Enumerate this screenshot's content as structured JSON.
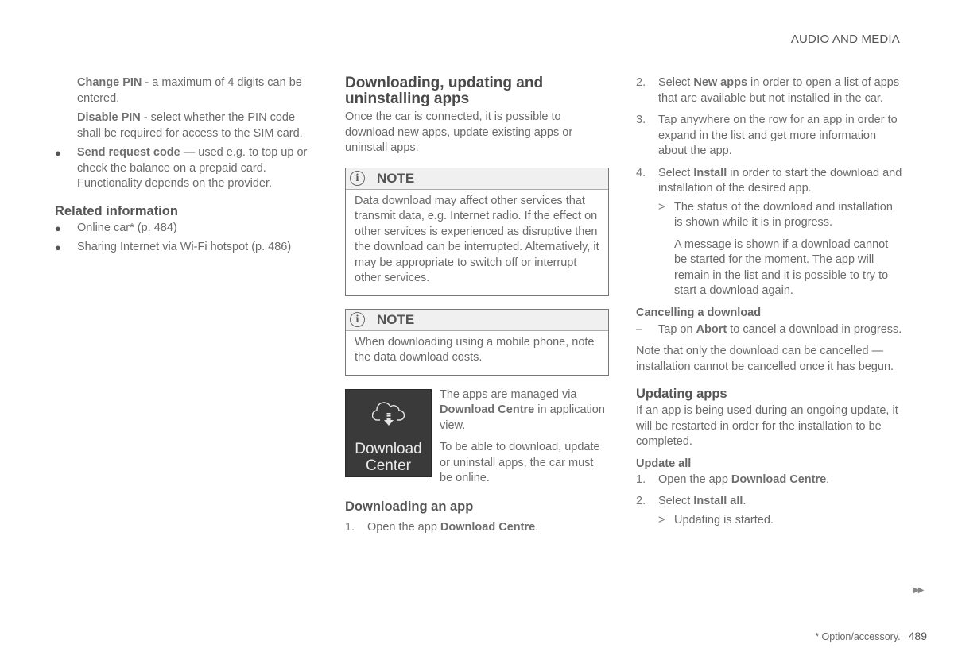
{
  "header": {
    "section_title": "AUDIO AND MEDIA"
  },
  "col1": {
    "change_pin_label": "Change PIN",
    "change_pin_text": " - a maximum of 4 digits can be entered.",
    "disable_pin_label": "Disable PIN",
    "disable_pin_text": " - select whether the PIN code shall be required for access to the SIM card.",
    "bullet_glyph": "●",
    "send_code_label": "Send request code",
    "send_code_text": " — used e.g. to top up or check the balance on a prepaid card. Functionality depends on the provider.",
    "related_heading": "Related information",
    "related_links": [
      {
        "text": "Online car* (p. 484)"
      },
      {
        "text": "Sharing Internet via Wi-Fi hotspot (p. 486)"
      }
    ]
  },
  "col2": {
    "main_heading": "Downloading, updating and uninstalling apps",
    "intro": "Once the car is connected, it is possible to download new apps, update existing apps or uninstall apps.",
    "notes": [
      {
        "icon": "info-icon",
        "icon_glyph": "i",
        "title": "NOTE",
        "body": "Data download may affect other services that transmit data, e.g. Internet radio. If the effect on other services is experienced as disruptive then the download can be interrupted. Alternatively, it may be appropriate to switch off or interrupt other services."
      },
      {
        "icon": "info-icon",
        "icon_glyph": "i",
        "title": "NOTE",
        "body": "When downloading using a mobile phone, note the data download costs."
      }
    ],
    "tile": {
      "icon": "cloud-download-icon",
      "label_line1": "Download",
      "label_line2": "Center"
    },
    "tile_text1_pre": "The apps are managed via ",
    "tile_text1_bold": "Download Centre",
    "tile_text1_post": " in application view.",
    "tile_text2": "To be able to download, update or uninstall apps, the car must be online.",
    "download_heading": "Downloading an app",
    "step1_num": "1.",
    "step1_pre": "Open the app ",
    "step1_bold": "Download Centre",
    "step1_post": "."
  },
  "col3": {
    "steps": [
      {
        "num": "2.",
        "pre": "Select ",
        "bold": "New apps",
        "post": " in order to open a list of apps that are available but not installed in the car."
      },
      {
        "num": "3.",
        "pre": "Tap anywhere on the row for an app in order to expand in the list and get more information about the app.",
        "bold": "",
        "post": ""
      },
      {
        "num": "4.",
        "pre": "Select ",
        "bold": "Install",
        "post": " in order to start the download and installation of the desired app."
      }
    ],
    "result_glyph": ">",
    "step4_result": "The status of the download and installation is shown while it is in progress.",
    "step4_result_extra": "A message is shown if a download cannot be started for the moment. The app will remain in the list and it is possible to try to start a download again.",
    "cancel_heading": "Cancelling a download",
    "cancel_dash": "–",
    "cancel_pre": "Tap on ",
    "cancel_bold": "Abort",
    "cancel_post": " to cancel a download in progress.",
    "cancel_note": "Note that only the download can be cancelled — installation cannot be cancelled once it has begun.",
    "updating_heading": "Updating apps",
    "updating_text": "If an app is being used during an ongoing update, it will be restarted in order for the installation to be completed.",
    "update_all_heading": "Update all",
    "update_steps": [
      {
        "num": "1.",
        "pre": "Open the app ",
        "bold": "Download Centre",
        "post": "."
      },
      {
        "num": "2.",
        "pre": "Select ",
        "bold": "Install all",
        "post": "."
      }
    ],
    "update_result": "Updating is started."
  },
  "footer": {
    "continue_glyph": "▶▶",
    "footnote": "* Option/accessory.",
    "page_number": "489"
  }
}
